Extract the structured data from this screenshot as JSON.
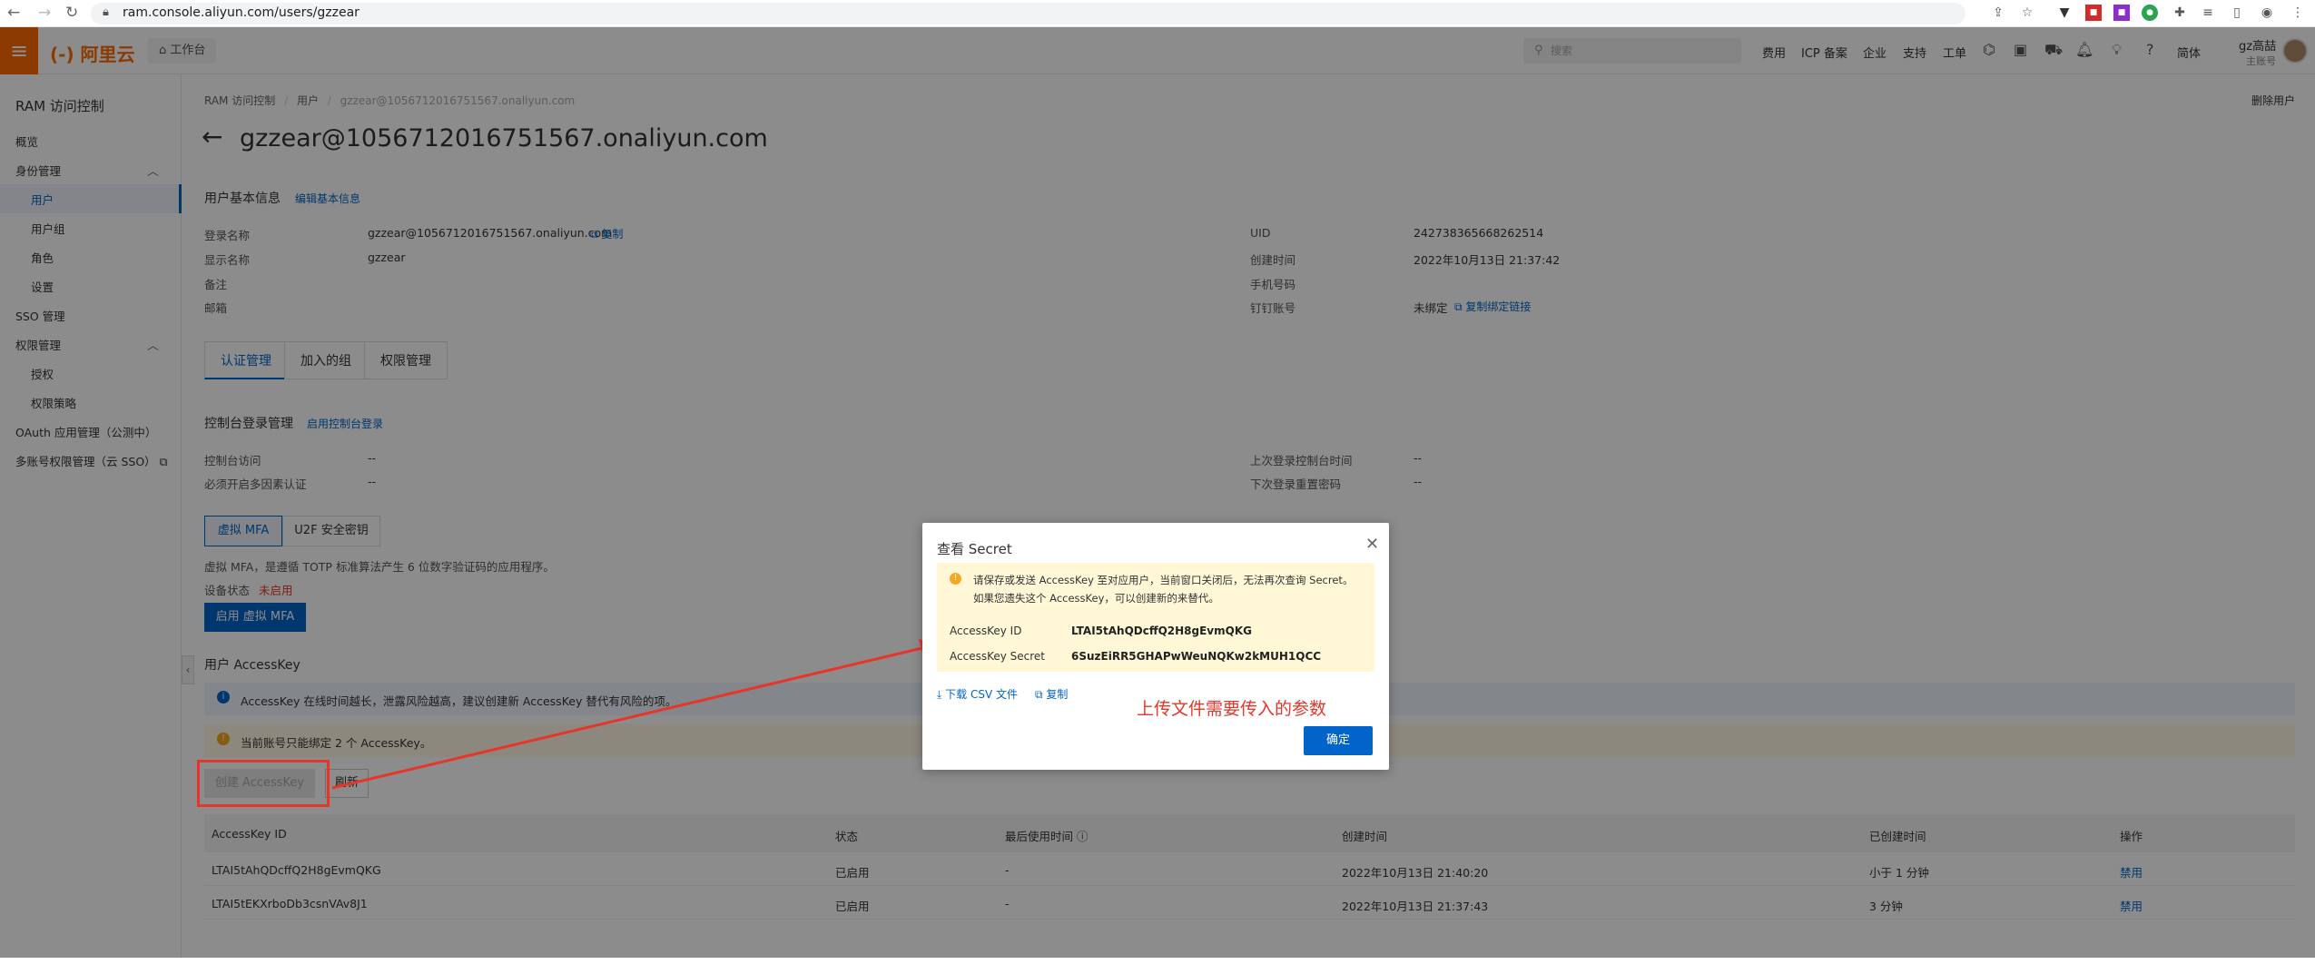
{
  "browser": {
    "url": "ram.console.aliyun.com/users/gzzear"
  },
  "topbar": {
    "logo": "(-) 阿里云",
    "workbench": "⌂ 工作台",
    "search_placeholder": "搜索",
    "links": [
      "费用",
      "ICP 备案",
      "企业",
      "支持",
      "工单"
    ],
    "lang": "简体",
    "user_name": "gz高喆",
    "user_role": "主账号"
  },
  "sidebar": {
    "title": "RAM 访问控制",
    "items": [
      "概览",
      "身份管理",
      "用户",
      "用户组",
      "角色",
      "设置",
      "SSO 管理",
      "权限管理",
      "授权",
      "权限策略",
      "OAuth 应用管理（公测中）",
      "多账号权限管理（云 SSO）"
    ]
  },
  "breadcrumb": [
    "RAM 访问控制",
    "用户",
    "gzzear@1056712016751567.onaliyun.com"
  ],
  "delete_user": "删除用户",
  "page_title": "gzzear@1056712016751567.onaliyun.com",
  "basic": {
    "title": "用户基本信息",
    "edit": "编辑基本信息",
    "login_name_label": "登录名称",
    "login_name": "gzzear@1056712016751567.onaliyun.com",
    "copy": "复制",
    "display_name_label": "显示名称",
    "display_name": "gzzear",
    "remark_label": "备注",
    "email_label": "邮箱",
    "uid_label": "UID",
    "uid": "242738365668262514",
    "created_label": "创建时间",
    "created": "2022年10月13日 21:37:42",
    "phone_label": "手机号码",
    "dingtalk_label": "钉钉账号",
    "dingtalk": "未绑定",
    "copy_bind": "复制绑定链接"
  },
  "tabs": [
    "认证管理",
    "加入的组",
    "权限管理"
  ],
  "console_login": {
    "title": "控制台登录管理",
    "enable_link": "启用控制台登录",
    "access_label": "控制台访问",
    "access_val": "--",
    "mfa_label": "必须开启多因素认证",
    "mfa_val": "--",
    "last_login_label": "上次登录控制台时间",
    "last_login_val": "--",
    "reset_label": "下次登录重置密码",
    "reset_val": "--"
  },
  "mfa": {
    "tabs": [
      "虚拟 MFA",
      "U2F 安全密钥"
    ],
    "desc": "虚拟 MFA，是遵循 TOTP 标准算法产生 6 位数字验证码的应用程序。",
    "status_label": "设备状态",
    "status": "未启用",
    "enable_btn": "启用 虚拟 MFA"
  },
  "accesskey": {
    "title": "用户 AccessKey",
    "info": "AccessKey 在线时间越长，泄露风险越高，建议创建新 AccessKey 替代有风险的项。",
    "warning": "当前账号只能绑定 2 个 AccessKey。",
    "create_btn": "创建 AccessKey",
    "refresh_btn": "刷新",
    "columns": [
      "AccessKey ID",
      "状态",
      "最后使用时间 ⓘ",
      "创建时间",
      "已创建时间",
      "操作"
    ],
    "rows": [
      [
        "LTAI5tAhQDcffQ2H8gEvmQKG",
        "已启用",
        "-",
        "2022年10月13日 21:40:20",
        "小于 1 分钟",
        "禁用"
      ],
      [
        "LTAI5tEKXrboDb3csnVAv8J1",
        "已启用",
        "-",
        "2022年10月13日 21:37:43",
        "3 分钟",
        "禁用"
      ]
    ]
  },
  "modal": {
    "title": "查看 Secret",
    "warning": "请保存或发送 AccessKey 至对应用户，当前窗口关闭后，无法再次查询 Secret。如果您遗失这个 AccessKey，可以创建新的来替代。",
    "id_label": "AccessKey ID",
    "id": "LTAI5tAhQDcffQ2H8gEvmQKG",
    "secret_label": "AccessKey Secret",
    "secret": "6SuzEiRR5GHAPwWeuNQKw2kMUH1QCC",
    "download": "下载 CSV 文件",
    "copy": "复制",
    "confirm": "确定"
  },
  "annotation": "上传文件需要传入的参数",
  "colors": {
    "brand": "#ff6a00",
    "accent": "#0064c8",
    "annotation": "#e8352a"
  }
}
